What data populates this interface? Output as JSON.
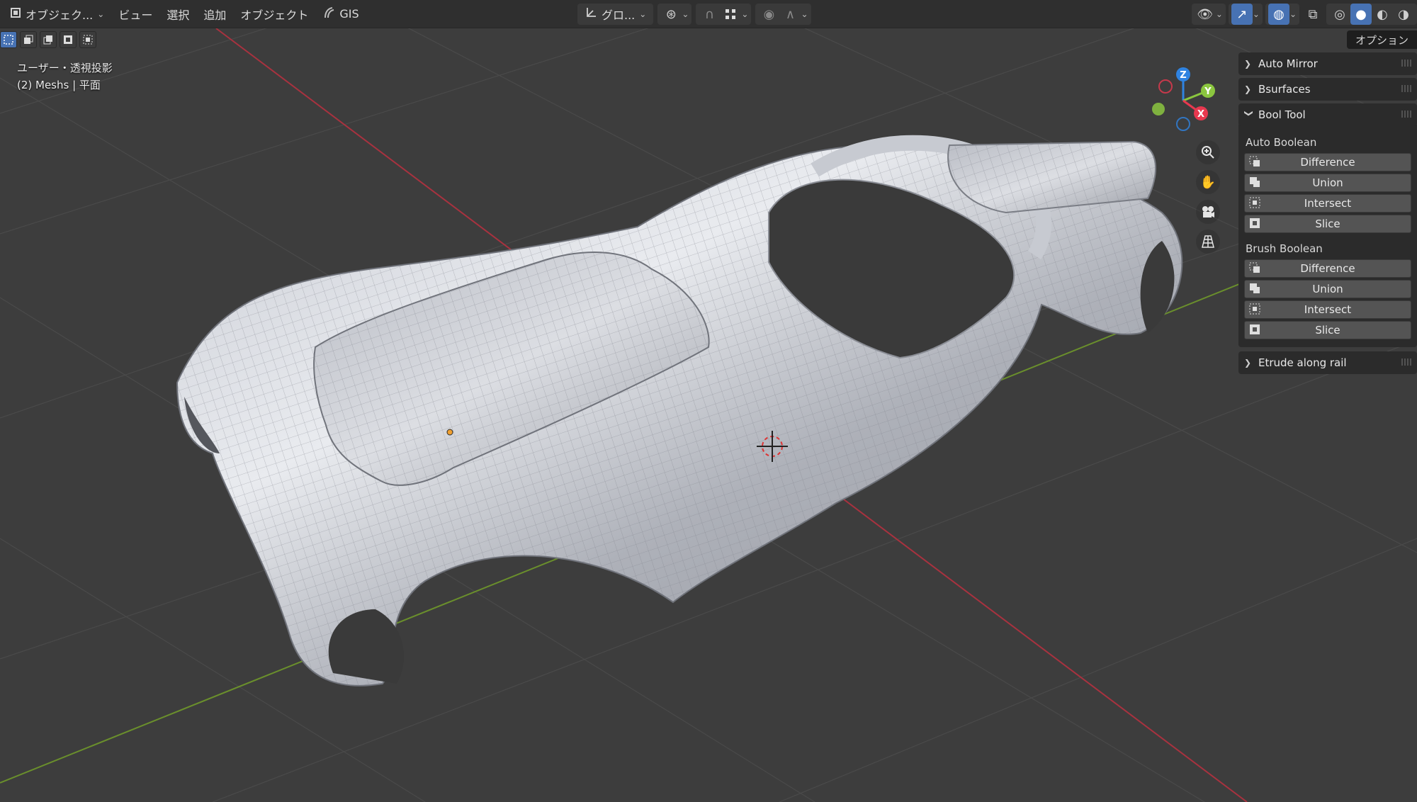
{
  "header": {
    "mode_label": "オブジェク...",
    "menus": [
      "ビュー",
      "選択",
      "追加",
      "オブジェクト"
    ],
    "gis_label": "GIS",
    "transform_orientation": "グロ..."
  },
  "options_tab": "オプション",
  "viewport": {
    "view_name": "ユーザー・透視投影",
    "collection_info": "(2) Meshs | 平面"
  },
  "gizmo": {
    "z": "Z",
    "y": "Y",
    "x": "X"
  },
  "sidebar": {
    "panels": [
      {
        "label": "Auto Mirror",
        "expanded": false
      },
      {
        "label": "Bsurfaces",
        "expanded": false
      },
      {
        "label": "Bool Tool",
        "expanded": true
      },
      {
        "label": "Etrude along rail",
        "expanded": false
      }
    ],
    "bool_tool": {
      "auto_boolean_label": "Auto Boolean",
      "brush_boolean_label": "Brush Boolean",
      "auto_buttons": [
        "Difference",
        "Union",
        "Intersect",
        "Slice"
      ],
      "brush_buttons": [
        "Difference",
        "Union",
        "Intersect",
        "Slice"
      ]
    }
  },
  "colors": {
    "viewport_bg": "#3d3d3d",
    "header_bg": "#2f2f2f",
    "accent_blue": "#4772b3",
    "x_axis": "#e8384f",
    "y_axis": "#8bc63f",
    "z_axis": "#2f83e1"
  }
}
